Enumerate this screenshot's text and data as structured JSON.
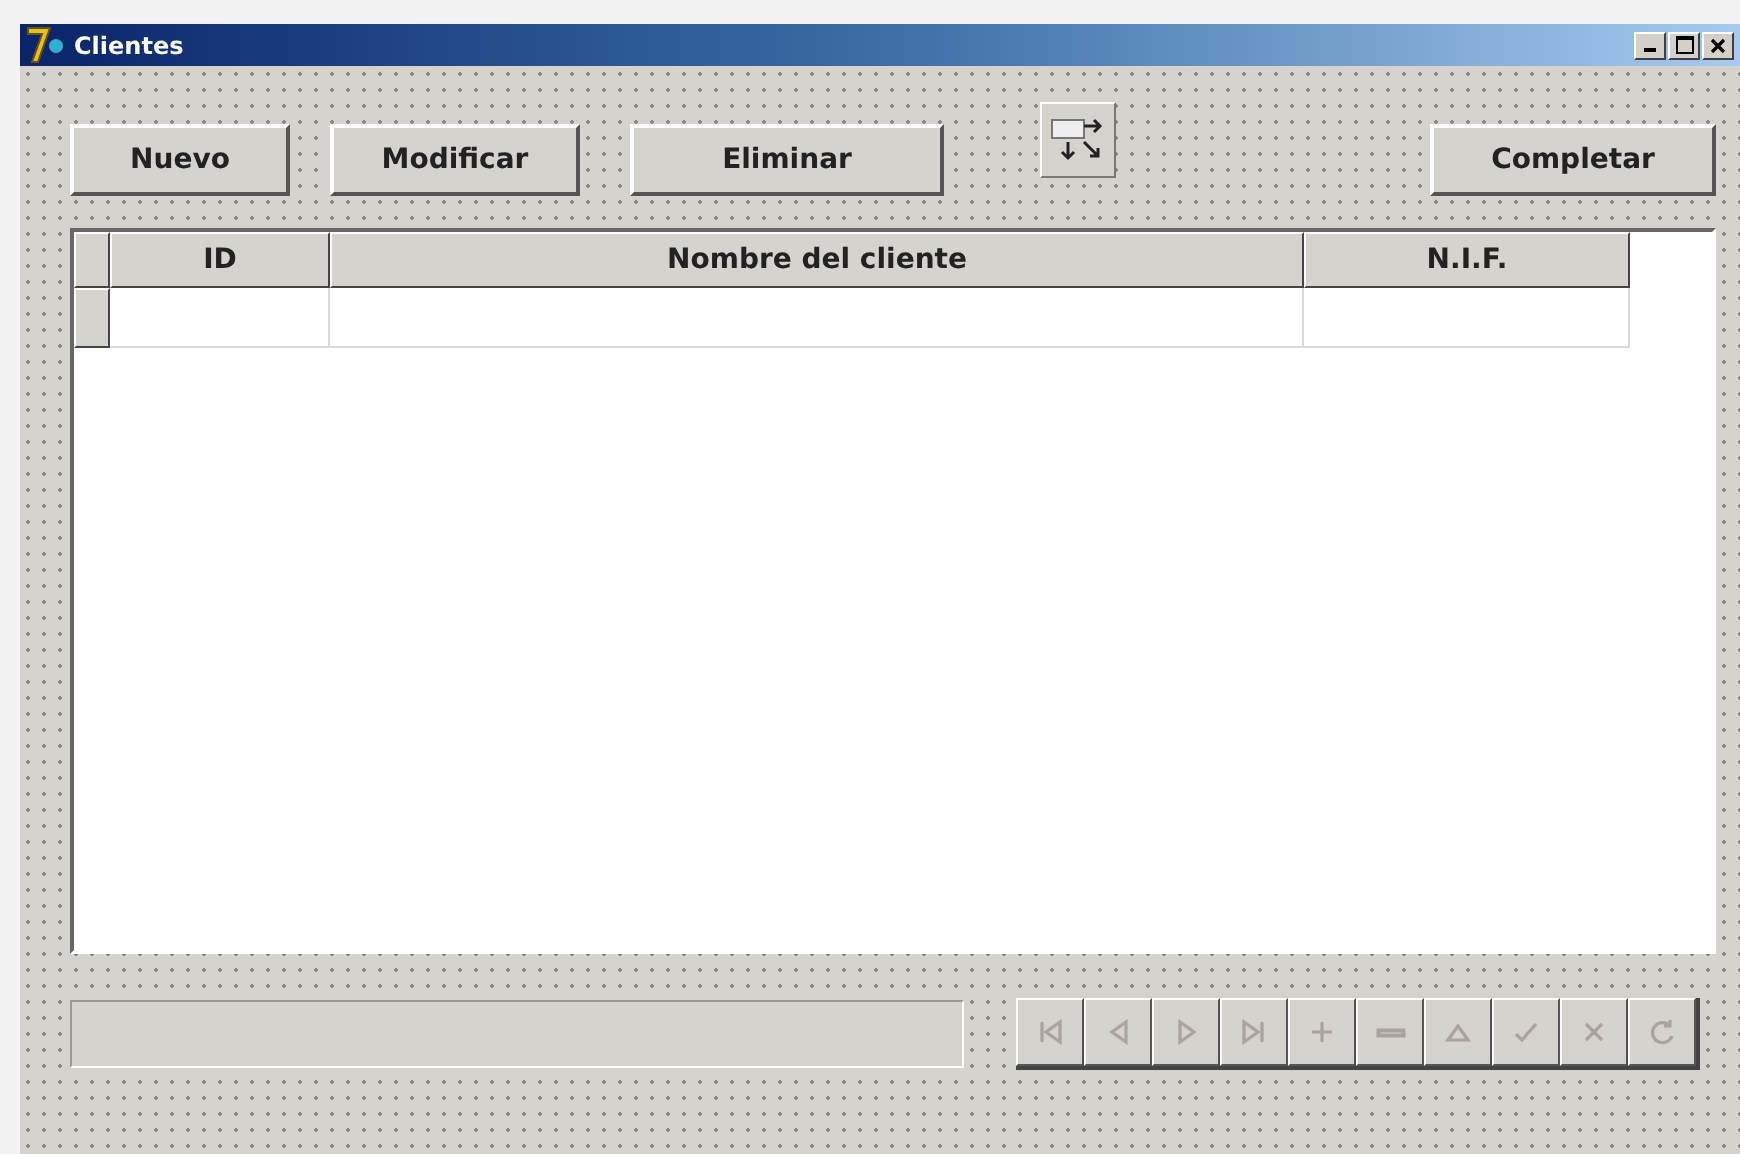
{
  "window": {
    "title": "Clientes"
  },
  "toolbar": {
    "buttons": [
      {
        "label": "Nuevo",
        "kind": "text"
      },
      {
        "label": "Modificar",
        "kind": "text"
      },
      {
        "label": "Eliminar",
        "kind": "text"
      },
      {
        "kind": "tab-order"
      },
      {
        "label": "Completar",
        "kind": "text"
      }
    ]
  },
  "table": {
    "columns": [
      "ID",
      "Nombre del cliente",
      "N.I.F."
    ]
  },
  "navigator": {
    "buttons": [
      {
        "kind": "first",
        "disabled": true
      },
      {
        "kind": "prior",
        "disabled": true
      },
      {
        "kind": "next",
        "disabled": true
      },
      {
        "kind": "last",
        "disabled": true
      },
      {
        "kind": "insert",
        "disabled": true
      },
      {
        "kind": "delete",
        "disabled": true
      },
      {
        "kind": "edit",
        "disabled": true
      },
      {
        "kind": "post",
        "disabled": true
      },
      {
        "kind": "cancel",
        "disabled": true
      },
      {
        "kind": "refresh",
        "disabled": true
      }
    ]
  }
}
